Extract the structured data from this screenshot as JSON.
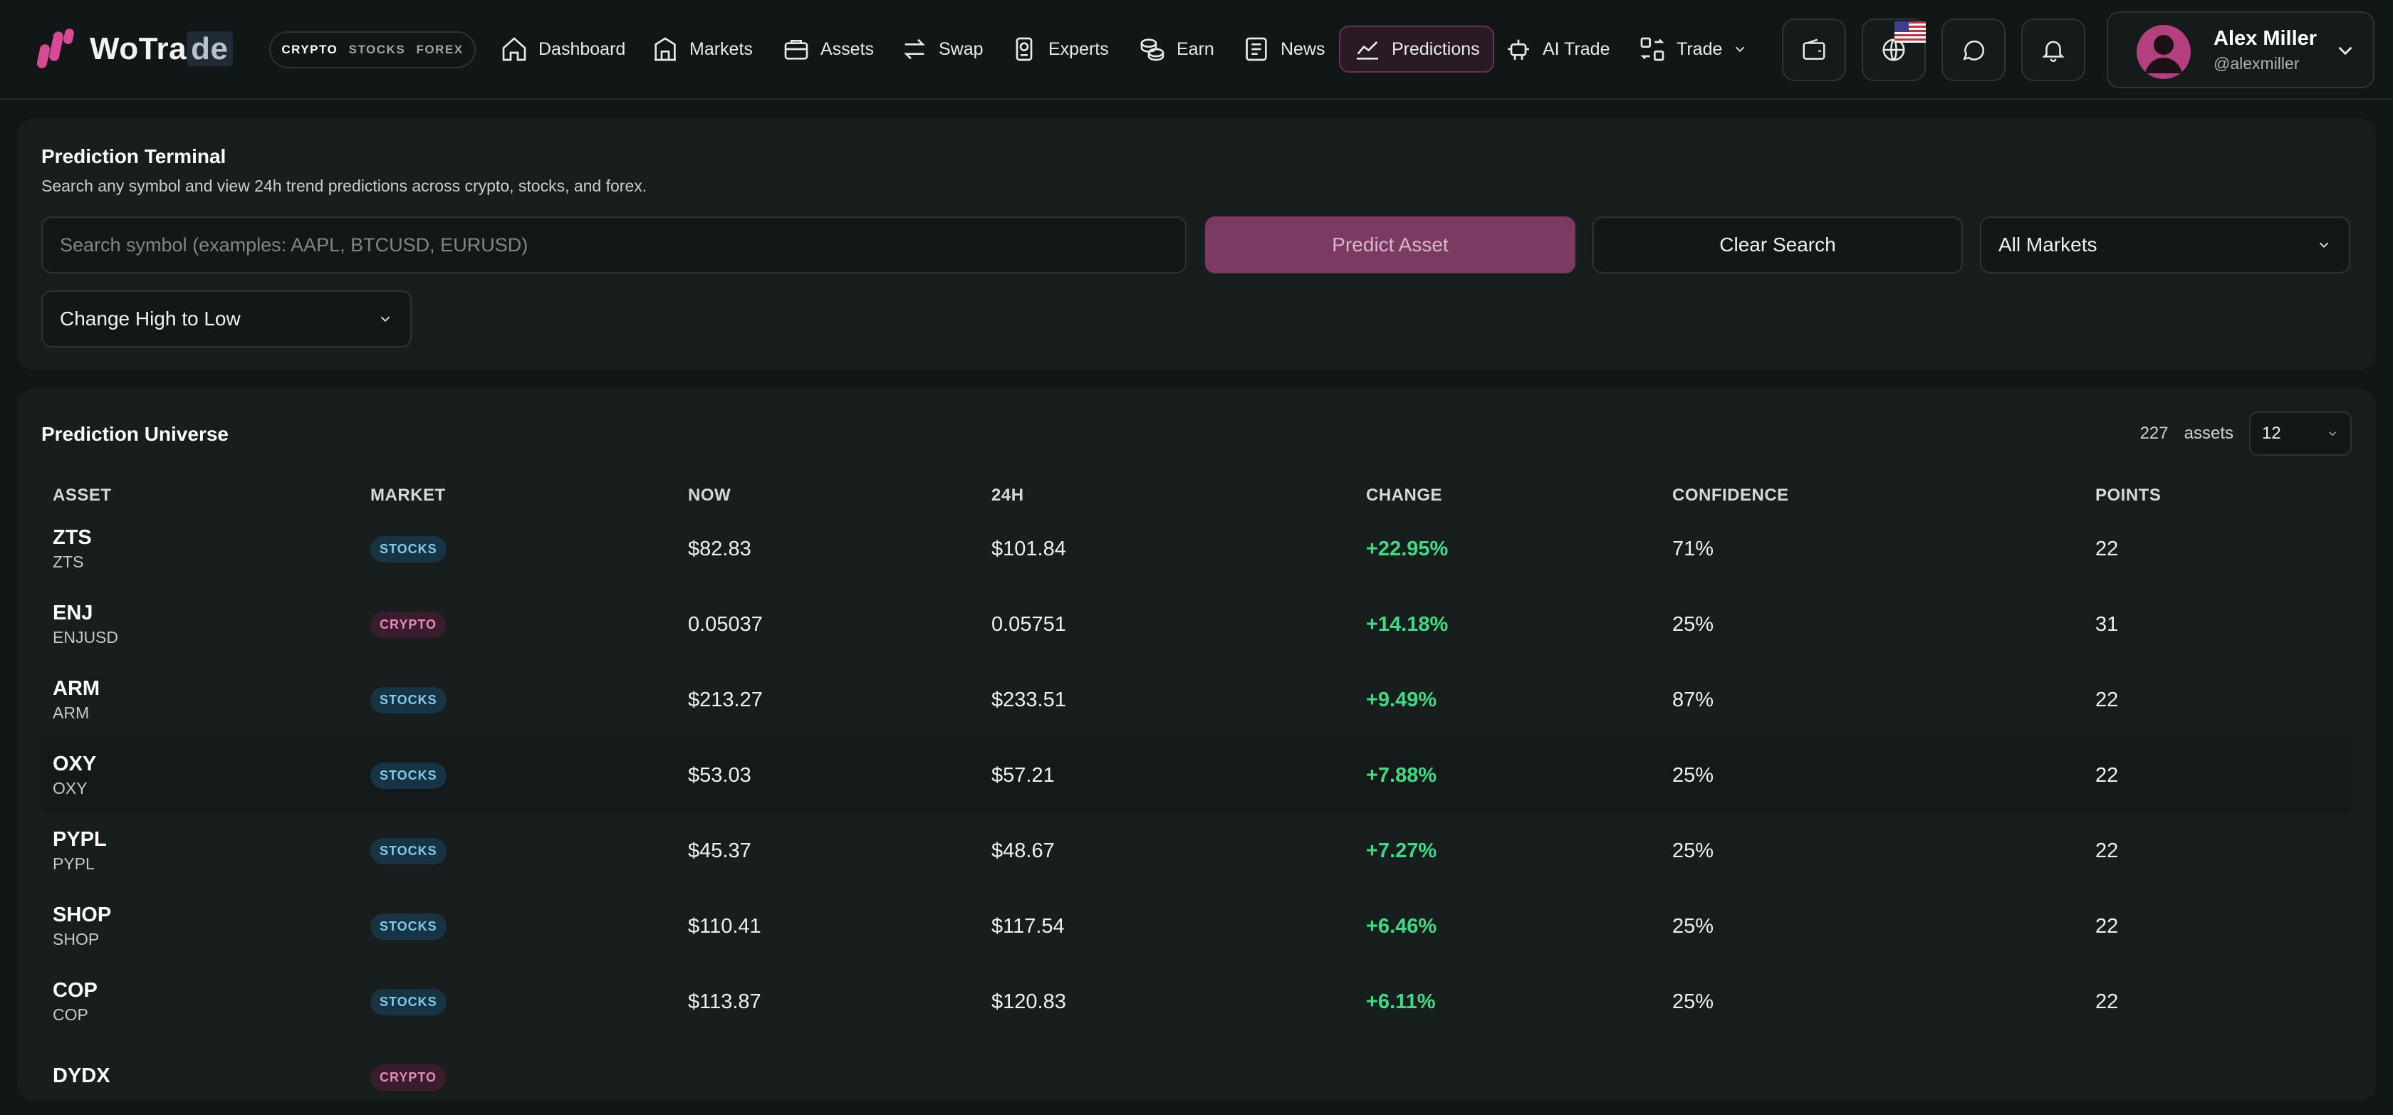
{
  "brand": {
    "name_main": "WoTra",
    "name_tail": "de"
  },
  "market_switch": [
    "CRYPTO",
    "STOCKS",
    "FOREX"
  ],
  "nav": {
    "dashboard": "Dashboard",
    "markets": "Markets",
    "assets": "Assets",
    "swap": "Swap",
    "experts": "Experts",
    "earn": "Earn",
    "news": "News",
    "predictions": "Predictions",
    "ai_trade": "AI Trade",
    "trade": "Trade"
  },
  "user": {
    "name": "Alex Miller",
    "handle": "@alexmiller"
  },
  "terminal": {
    "title": "Prediction Terminal",
    "subtitle": "Search any symbol and view 24h trend predictions across crypto, stocks, and forex.",
    "search_placeholder": "Search symbol (examples: AAPL, BTCUSD, EURUSD)",
    "predict_label": "Predict Asset",
    "clear_label": "Clear Search",
    "market_filter": "All Markets",
    "sort_value": "Change High to Low"
  },
  "universe": {
    "title": "Prediction Universe",
    "count": "227",
    "count_label": "assets",
    "page_size": "12",
    "columns": [
      "ASSET",
      "MARKET",
      "NOW",
      "24H",
      "CHANGE",
      "CONFIDENCE",
      "POINTS"
    ],
    "rows": [
      {
        "symbol": "ZTS",
        "ticker": "ZTS",
        "market": "STOCKS",
        "now": "$82.83",
        "h24": "$101.84",
        "change": "+22.95%",
        "confidence": "71%",
        "points": "22"
      },
      {
        "symbol": "ENJ",
        "ticker": "ENJUSD",
        "market": "CRYPTO",
        "now": "0.05037",
        "h24": "0.05751",
        "change": "+14.18%",
        "confidence": "25%",
        "points": "31"
      },
      {
        "symbol": "ARM",
        "ticker": "ARM",
        "market": "STOCKS",
        "now": "$213.27",
        "h24": "$233.51",
        "change": "+9.49%",
        "confidence": "87%",
        "points": "22"
      },
      {
        "symbol": "OXY",
        "ticker": "OXY",
        "market": "STOCKS",
        "now": "$53.03",
        "h24": "$57.21",
        "change": "+7.88%",
        "confidence": "25%",
        "points": "22"
      },
      {
        "symbol": "PYPL",
        "ticker": "PYPL",
        "market": "STOCKS",
        "now": "$45.37",
        "h24": "$48.67",
        "change": "+7.27%",
        "confidence": "25%",
        "points": "22"
      },
      {
        "symbol": "SHOP",
        "ticker": "SHOP",
        "market": "STOCKS",
        "now": "$110.41",
        "h24": "$117.54",
        "change": "+6.46%",
        "confidence": "25%",
        "points": "22"
      },
      {
        "symbol": "COP",
        "ticker": "COP",
        "market": "STOCKS",
        "now": "$113.87",
        "h24": "$120.83",
        "change": "+6.11%",
        "confidence": "25%",
        "points": "22"
      },
      {
        "symbol": "DYDX",
        "ticker": "",
        "market": "CRYPTO",
        "now": "",
        "h24": "",
        "change": "",
        "confidence": "",
        "points": ""
      }
    ]
  },
  "colors": {
    "accent": "#7a3a61",
    "positive": "#3ddc84",
    "background": "#111716",
    "panel": "#171e1d"
  },
  "icons": [
    "home-icon",
    "bank-icon",
    "briefcase-icon",
    "swap-icon",
    "medal-icon",
    "coins-icon",
    "newspaper-icon",
    "chart-line-icon",
    "robot-icon",
    "transfer-icon",
    "wallet-icon",
    "globe-icon",
    "chat-icon",
    "bell-icon",
    "user-avatar-icon",
    "chevron-down-icon"
  ]
}
